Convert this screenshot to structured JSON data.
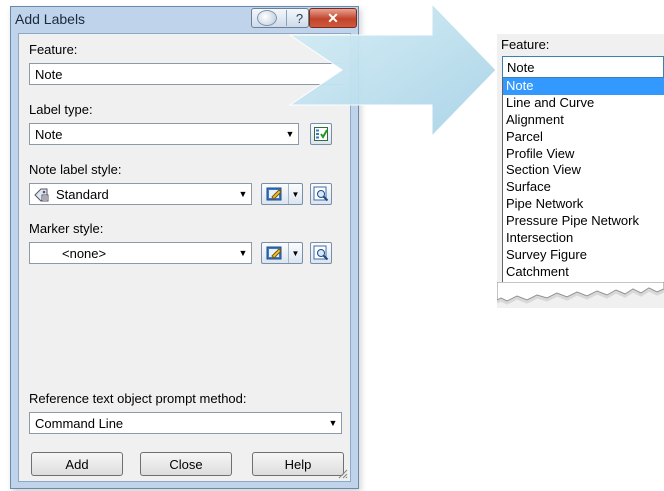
{
  "window": {
    "title": "Add Labels",
    "help_glyph": "?",
    "close_glyph": "✕"
  },
  "dialog": {
    "feature": {
      "label": "Feature:",
      "value": "Note"
    },
    "label_type": {
      "label": "Label type:",
      "value": "Note"
    },
    "note_label_style": {
      "label": "Note label style:",
      "value": "Standard"
    },
    "marker_style": {
      "label": "Marker style:",
      "value": "<none>"
    },
    "reference": {
      "label": "Reference text object prompt method:",
      "value": "Command Line"
    },
    "buttons": {
      "add": "Add",
      "close": "Close",
      "help": "Help"
    }
  },
  "dropdown": {
    "label": "Feature:",
    "value": "Note",
    "items": [
      "Note",
      "Line and Curve",
      "Alignment",
      "Parcel",
      "Profile View",
      "Section View",
      "Surface",
      "Pipe Network",
      "Pressure Pipe Network",
      "Intersection",
      "Survey Figure",
      "Catchment"
    ],
    "selected_index": 0
  },
  "colors": {
    "selection": "#3399ff",
    "window_frame": "#bfd4ea",
    "arrow_fill": "#b3dbe9"
  },
  "icons": [
    "help-icon",
    "close-icon",
    "label-type-settings-icon",
    "style-icon",
    "edit-style-icon",
    "browse-style-icon",
    "size-grip-icon"
  ]
}
